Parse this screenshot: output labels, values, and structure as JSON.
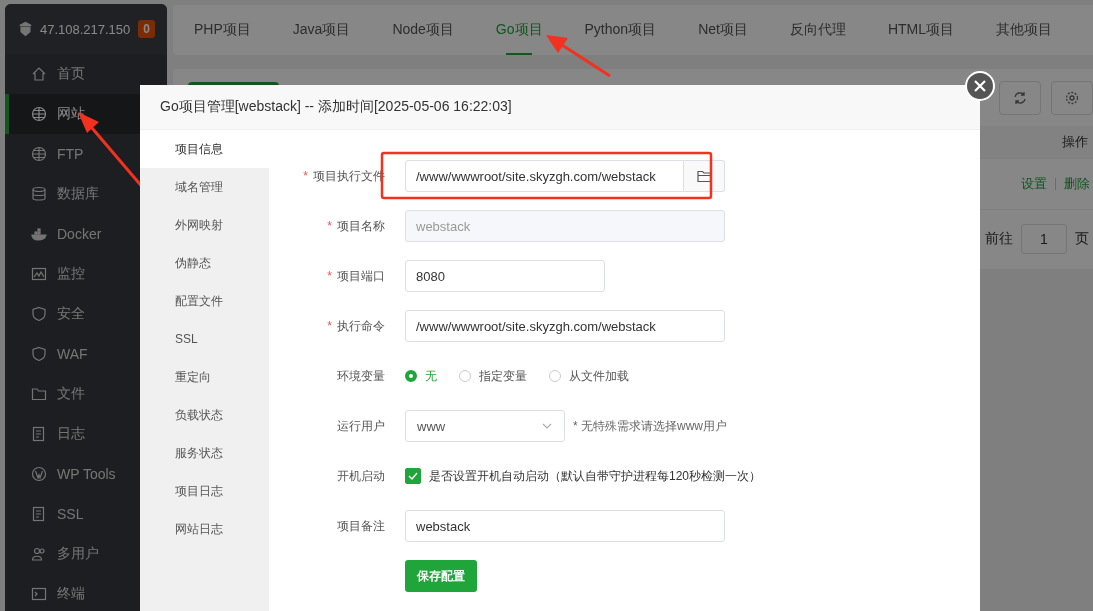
{
  "server": {
    "ip": "47.108.217.150",
    "badge": "0"
  },
  "sidebar": {
    "items": [
      {
        "label": "首页",
        "selected": false
      },
      {
        "label": "网站",
        "selected": true
      },
      {
        "label": "FTP",
        "selected": false
      },
      {
        "label": "数据库",
        "selected": false
      },
      {
        "label": "Docker",
        "selected": false
      },
      {
        "label": "监控",
        "selected": false
      },
      {
        "label": "安全",
        "selected": false
      },
      {
        "label": "WAF",
        "selected": false
      },
      {
        "label": "文件",
        "selected": false
      },
      {
        "label": "日志",
        "selected": false
      },
      {
        "label": "WP Tools",
        "selected": false
      },
      {
        "label": "SSL",
        "selected": false
      },
      {
        "label": "多用户",
        "selected": false
      },
      {
        "label": "终端",
        "selected": false
      }
    ]
  },
  "tabs": [
    {
      "label": "PHP项目",
      "selected": false
    },
    {
      "label": "Java项目",
      "selected": false
    },
    {
      "label": "Node项目",
      "selected": false
    },
    {
      "label": "Go项目",
      "selected": true
    },
    {
      "label": "Python项目",
      "selected": false
    },
    {
      "label": "Net项目",
      "selected": false
    },
    {
      "label": "反向代理",
      "selected": false
    },
    {
      "label": "HTML项目",
      "selected": false
    },
    {
      "label": "其他项目",
      "selected": false
    }
  ],
  "table": {
    "columns": [
      {
        "label": "操作"
      }
    ],
    "rows": [
      {
        "actions": [
          "设置",
          "删除"
        ]
      }
    ]
  },
  "pagination": {
    "goto_label": "前往",
    "page": "1",
    "page_suffix": "页"
  },
  "modal": {
    "title": "Go项目管理[webstack] -- 添加时间[2025-05-06 16:22:03]",
    "nav": [
      {
        "label": "项目信息",
        "selected": true
      },
      {
        "label": "域名管理",
        "selected": false
      },
      {
        "label": "外网映射",
        "selected": false
      },
      {
        "label": "伪静态",
        "selected": false
      },
      {
        "label": "配置文件",
        "selected": false
      },
      {
        "label": "SSL",
        "selected": false
      },
      {
        "label": "重定向",
        "selected": false
      },
      {
        "label": "负载状态",
        "selected": false
      },
      {
        "label": "服务状态",
        "selected": false
      },
      {
        "label": "项目日志",
        "selected": false
      },
      {
        "label": "网站日志",
        "selected": false
      }
    ],
    "fields": [
      {
        "kind": "path",
        "label": "项目执行文件",
        "required_mark": "*",
        "value": "/www/wwwroot/site.skyzgh.com/webstack",
        "disabled": false
      },
      {
        "kind": "text",
        "label": "项目名称",
        "required_mark": "*",
        "value": "webstack",
        "disabled": true
      },
      {
        "kind": "short",
        "label": "项目端口",
        "required_mark": "*",
        "value": "8080",
        "disabled": false
      },
      {
        "kind": "text",
        "label": "执行命令",
        "required_mark": "*",
        "value": "/www/wwwroot/site.skyzgh.com/webstack",
        "disabled": false
      },
      {
        "kind": "radio",
        "label": "环境变量",
        "options": [
          {
            "label": "无",
            "selected": true
          },
          {
            "label": "指定变量",
            "selected": false
          },
          {
            "label": "从文件加载",
            "selected": false
          }
        ]
      },
      {
        "kind": "select",
        "label": "运行用户",
        "value": "www",
        "hint": "* 无特殊需求请选择www用户"
      },
      {
        "kind": "checkbox",
        "label": "开机启动",
        "checked": true,
        "text": "是否设置开机自动启动（默认自带守护进程每120秒检测一次）"
      },
      {
        "kind": "text",
        "label": "项目备注",
        "value": "webstack",
        "disabled": false
      }
    ],
    "save_button": "保存配置"
  }
}
